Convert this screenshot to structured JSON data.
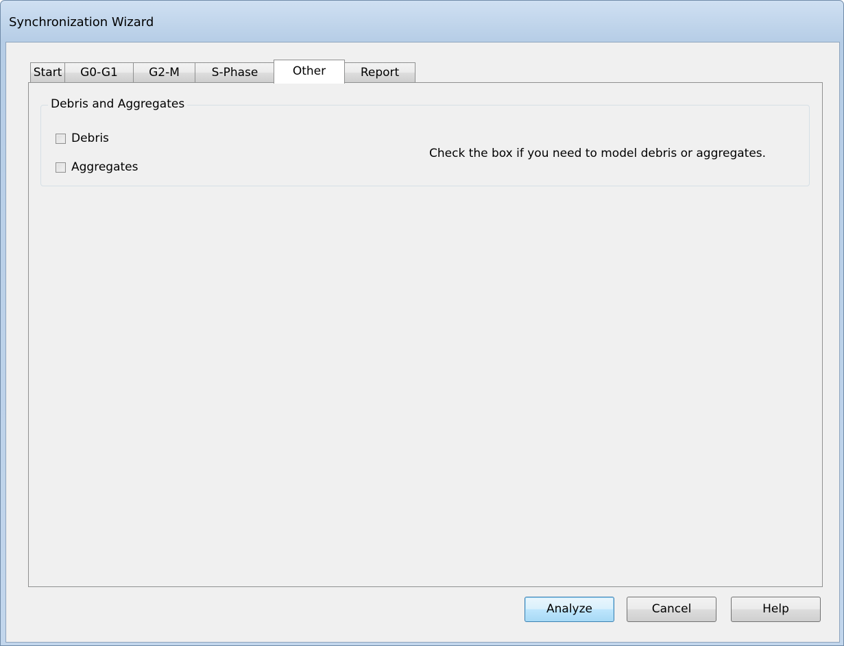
{
  "window": {
    "title": "Synchronization Wizard"
  },
  "tabs": [
    {
      "label": "Start",
      "active": false
    },
    {
      "label": "G0-G1",
      "active": false
    },
    {
      "label": "G2-M",
      "active": false
    },
    {
      "label": "S-Phase",
      "active": false
    },
    {
      "label": "Other",
      "active": true
    },
    {
      "label": "Report",
      "active": false
    }
  ],
  "other_tab": {
    "group_title": "Debris and Aggregates",
    "checkboxes": [
      {
        "label": "Debris",
        "checked": false
      },
      {
        "label": "Aggregates",
        "checked": false
      }
    ],
    "hint": "Check the box if you need to model debris or aggregates."
  },
  "buttons": {
    "analyze": "Analyze",
    "cancel": "Cancel",
    "help": "Help"
  }
}
